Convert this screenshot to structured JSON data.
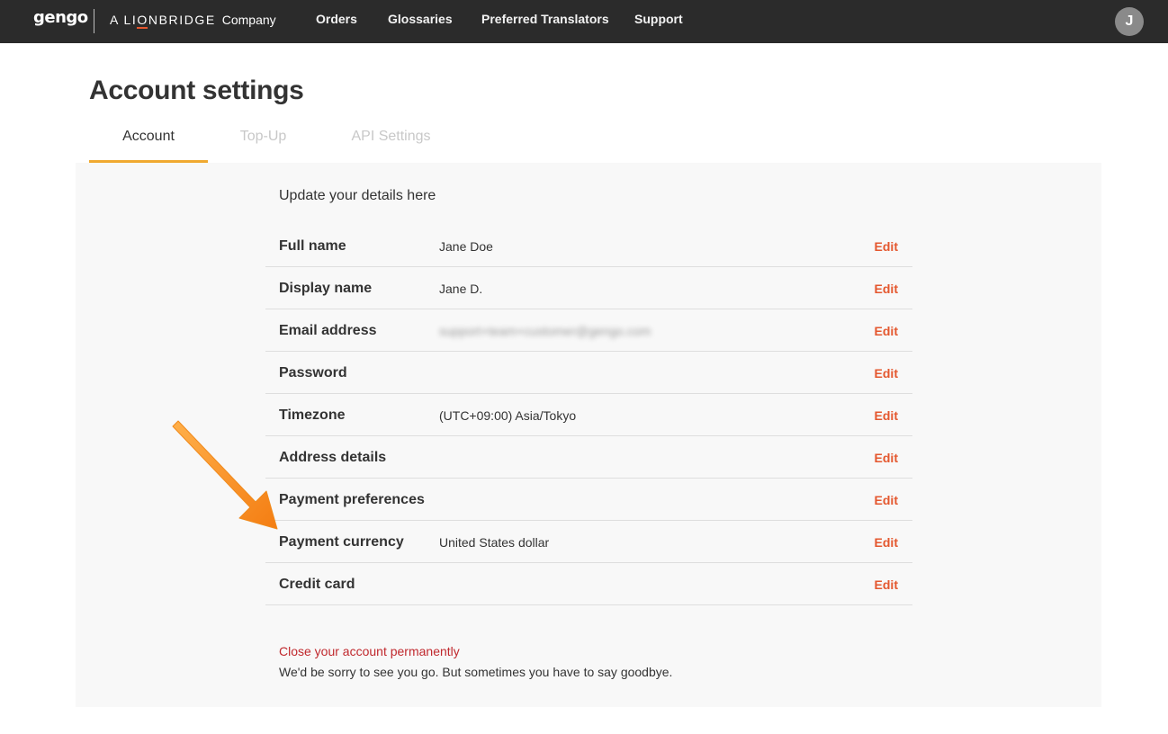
{
  "header": {
    "logo": "gengo",
    "company_prefix": "A",
    "company_brand_pre": "LI",
    "company_brand_o": "O",
    "company_brand_post": "NBRIDGE",
    "company_suffix": "Company",
    "nav": [
      {
        "label": "Orders"
      },
      {
        "label": "Glossaries"
      },
      {
        "label": "Preferred Translators"
      },
      {
        "label": "Support"
      }
    ],
    "avatar_initial": "J"
  },
  "page": {
    "title": "Account settings",
    "tabs": [
      {
        "label": "Account",
        "active": true
      },
      {
        "label": "Top-Up",
        "active": false
      },
      {
        "label": "API Settings",
        "active": false
      }
    ],
    "intro": "Update your details here",
    "rows": [
      {
        "label": "Full name",
        "value": "Jane Doe",
        "edit": "Edit"
      },
      {
        "label": "Display name",
        "value": "Jane D.",
        "edit": "Edit"
      },
      {
        "label": "Email address",
        "value": "support+team+customer@gengo.com",
        "edit": "Edit"
      },
      {
        "label": "Password",
        "value": "",
        "edit": "Edit"
      },
      {
        "label": "Timezone",
        "value": "(UTC+09:00) Asia/Tokyo",
        "edit": "Edit"
      },
      {
        "label": "Address details",
        "value": "",
        "edit": "Edit"
      },
      {
        "label": "Payment preferences",
        "value": "",
        "edit": "Edit"
      },
      {
        "label": "Payment currency",
        "value": "United States dollar",
        "edit": "Edit"
      },
      {
        "label": "Credit card",
        "value": "",
        "edit": "Edit"
      }
    ],
    "close_account_link": "Close your account permanently",
    "close_account_note": "We'd be sorry to see you go. But sometimes you have to say goodbye."
  },
  "colors": {
    "topbar": "#2b2b2b",
    "accent_edit": "#e4572e",
    "tab_underline": "#f0a930",
    "danger_link": "#c0282d",
    "annotation_arrow": "#f7931e"
  },
  "annotation": {
    "icon": "orange-arrow-icon",
    "points_to": "Payment currency"
  }
}
